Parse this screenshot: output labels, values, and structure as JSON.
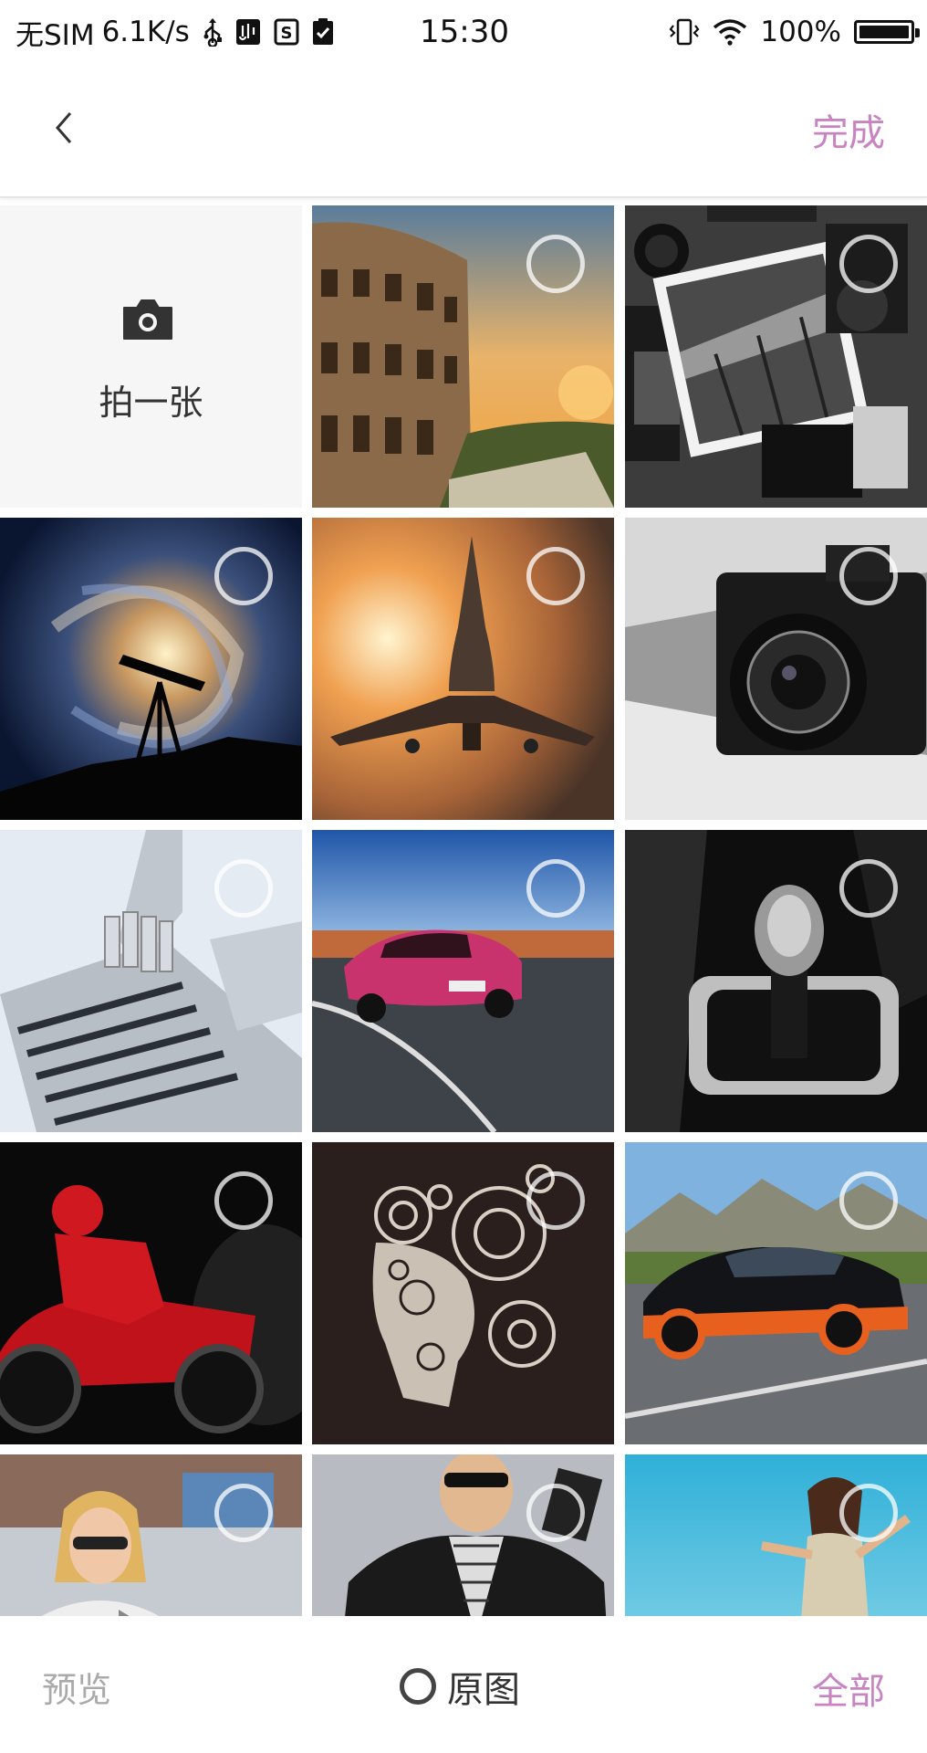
{
  "status_bar": {
    "carrier": "无SIM",
    "speed": "6.1K/s",
    "time": "15:30",
    "battery": "100%",
    "battery_level": 1.0
  },
  "header": {
    "back_icon": "chevron-left-icon",
    "done_label": "完成",
    "accent_color": "#c784c0"
  },
  "camera_tile": {
    "icon": "camera-icon",
    "label": "拍一张"
  },
  "photos": [
    {
      "subject": "colosseum"
    },
    {
      "subject": "camera-gear"
    },
    {
      "subject": "galaxy-telescope"
    },
    {
      "subject": "jet-fighter"
    },
    {
      "subject": "camera-closeup"
    },
    {
      "subject": "robot-laptop"
    },
    {
      "subject": "pink-sports-car"
    },
    {
      "subject": "gear-shift"
    },
    {
      "subject": "motorcycle-rider"
    },
    {
      "subject": "gear-head"
    },
    {
      "subject": "black-orange-supercar"
    },
    {
      "subject": "woman-sunglasses"
    },
    {
      "subject": "man-leather-jacket"
    },
    {
      "subject": "woman-beach"
    }
  ],
  "bottom_bar": {
    "preview_label": "预览",
    "original_label": "原图",
    "all_label": "全部"
  }
}
